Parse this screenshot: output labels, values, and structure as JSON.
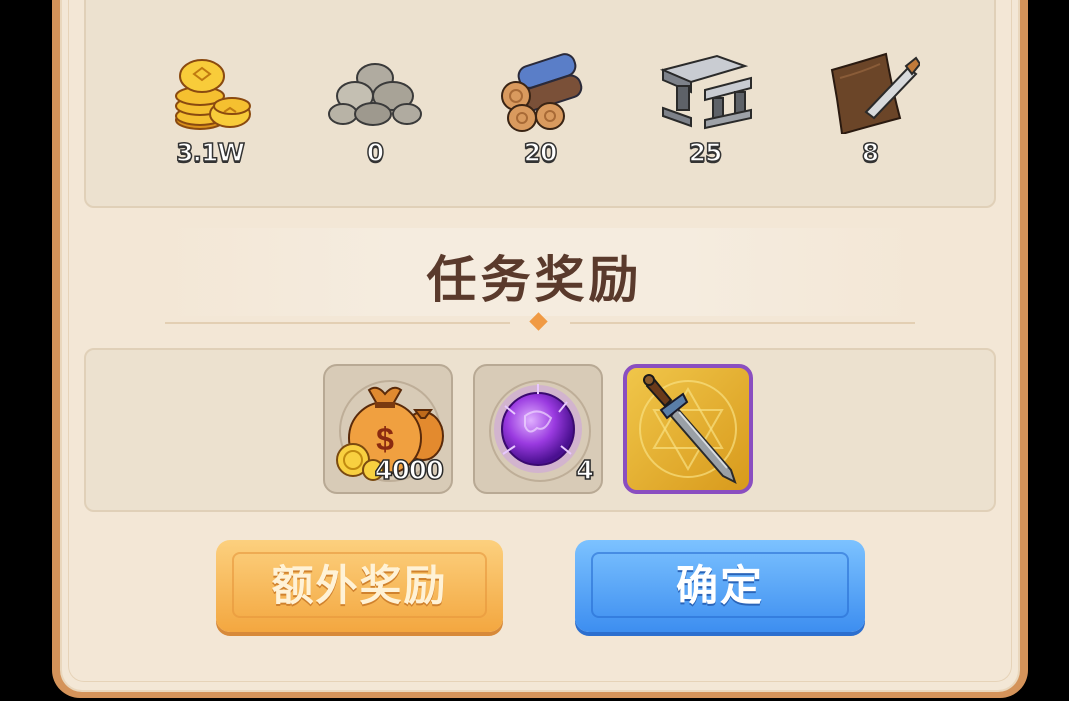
{
  "resources": [
    {
      "icon": "gold-coins-icon",
      "value": "3.1W"
    },
    {
      "icon": "stone-icon",
      "value": "0"
    },
    {
      "icon": "wood-logs-icon",
      "value": "20"
    },
    {
      "icon": "iron-ingot-icon",
      "value": "25"
    },
    {
      "icon": "leather-icon",
      "value": "8"
    }
  ],
  "section_title": "任务奖励",
  "rewards": [
    {
      "icon": "money-bag-icon",
      "count": "4000"
    },
    {
      "icon": "purple-crystal-orb-icon",
      "count": "4"
    },
    {
      "icon": "sword-icon",
      "count": ""
    }
  ],
  "buttons": {
    "extra_label": "额外奖励",
    "confirm_label": "确定"
  },
  "colors": {
    "panel_border": "#d4935a",
    "panel_bg": "#f3e7d6",
    "accent_orange": "#f3a740",
    "accent_blue": "#3d8ef0",
    "title_text": "#5a3a2c",
    "rare_border": "#8a4ec0"
  }
}
